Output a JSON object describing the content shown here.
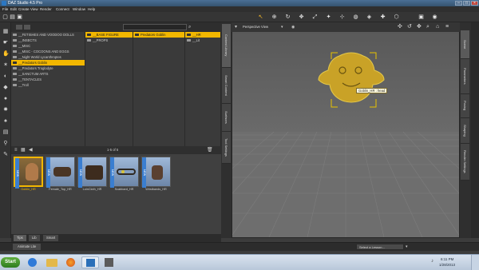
{
  "window": {
    "title": "DAZ Studio 4.5 Pro",
    "controls": [
      "–",
      "□",
      "×"
    ]
  },
  "menu": [
    "File",
    "Edit",
    "Create",
    "View",
    "Render",
    "Connect",
    "Window",
    "Help"
  ],
  "content_library": {
    "folders_col1": [
      {
        "label": "__FETISHES AND VOODOO DOLLS",
        "selected": false
      },
      {
        "label": "__INSECTS",
        "selected": false
      },
      {
        "label": "__MISC",
        "selected": false
      },
      {
        "label": "__MISC - COCOONS AND EGGS",
        "selected": false
      },
      {
        "label": "__Night World LycanthropIes",
        "selected": false
      },
      {
        "label": "__Predators Goblin",
        "selected": true
      },
      {
        "label": "__Predators Troglodyte",
        "selected": false
      },
      {
        "label": "__SANCTUM ARTS",
        "selected": false
      },
      {
        "label": "__TENTACLES",
        "selected": false
      },
      {
        "label": "__Troll",
        "selected": false
      }
    ],
    "folders_col2": [
      {
        "label": "__BASE FIGURE",
        "selected": true
      },
      {
        "label": "__PROPS",
        "selected": false
      }
    ],
    "folders_col3": [
      {
        "label": "Predators Goblin",
        "selected": true
      }
    ],
    "folders_col4": [
      {
        "label": "__HR",
        "selected": true
      },
      {
        "label": "__Lit",
        "selected": false
      }
    ],
    "page_info": "1-5 of 5"
  },
  "thumbnails": [
    {
      "label": "Goblin_HR",
      "selected": true,
      "badge": "NEW"
    },
    {
      "label": "Female_Top_HR",
      "selected": false,
      "badge": "NEW"
    },
    {
      "label": "LoinCloth_HR",
      "selected": false,
      "badge": "NEW"
    },
    {
      "label": "Scabbard_HR",
      "selected": false,
      "badge": "NEW"
    },
    {
      "label": "Wristbands_HR",
      "selected": false,
      "badge": "NEW"
    }
  ],
  "bottom_tabs": [
    "Tips",
    "Lib",
    "Smart"
  ],
  "viewport": {
    "camera_label": "Perspective View",
    "tooltip": "Goblin_HR : head"
  },
  "status": {
    "lesson_label": "Animate Lite",
    "lesson_button": "Select a Lesson..."
  },
  "side_tabs_left": [
    "Content Library",
    "Smart Content",
    "Surfaces",
    "Tool Settings"
  ],
  "side_tabs_right": [
    "Scene",
    "Parameters",
    "Posing",
    "Shaping",
    "Render Settings"
  ],
  "taskbar": {
    "start_label": "Start",
    "time": "6:11 PM",
    "date": "1/28/2013"
  },
  "colors": {
    "accent": "#f2b700",
    "panel": "#3d3d3d",
    "viewport_floor": "#6e6e6e",
    "goblin": "#c9a227"
  }
}
